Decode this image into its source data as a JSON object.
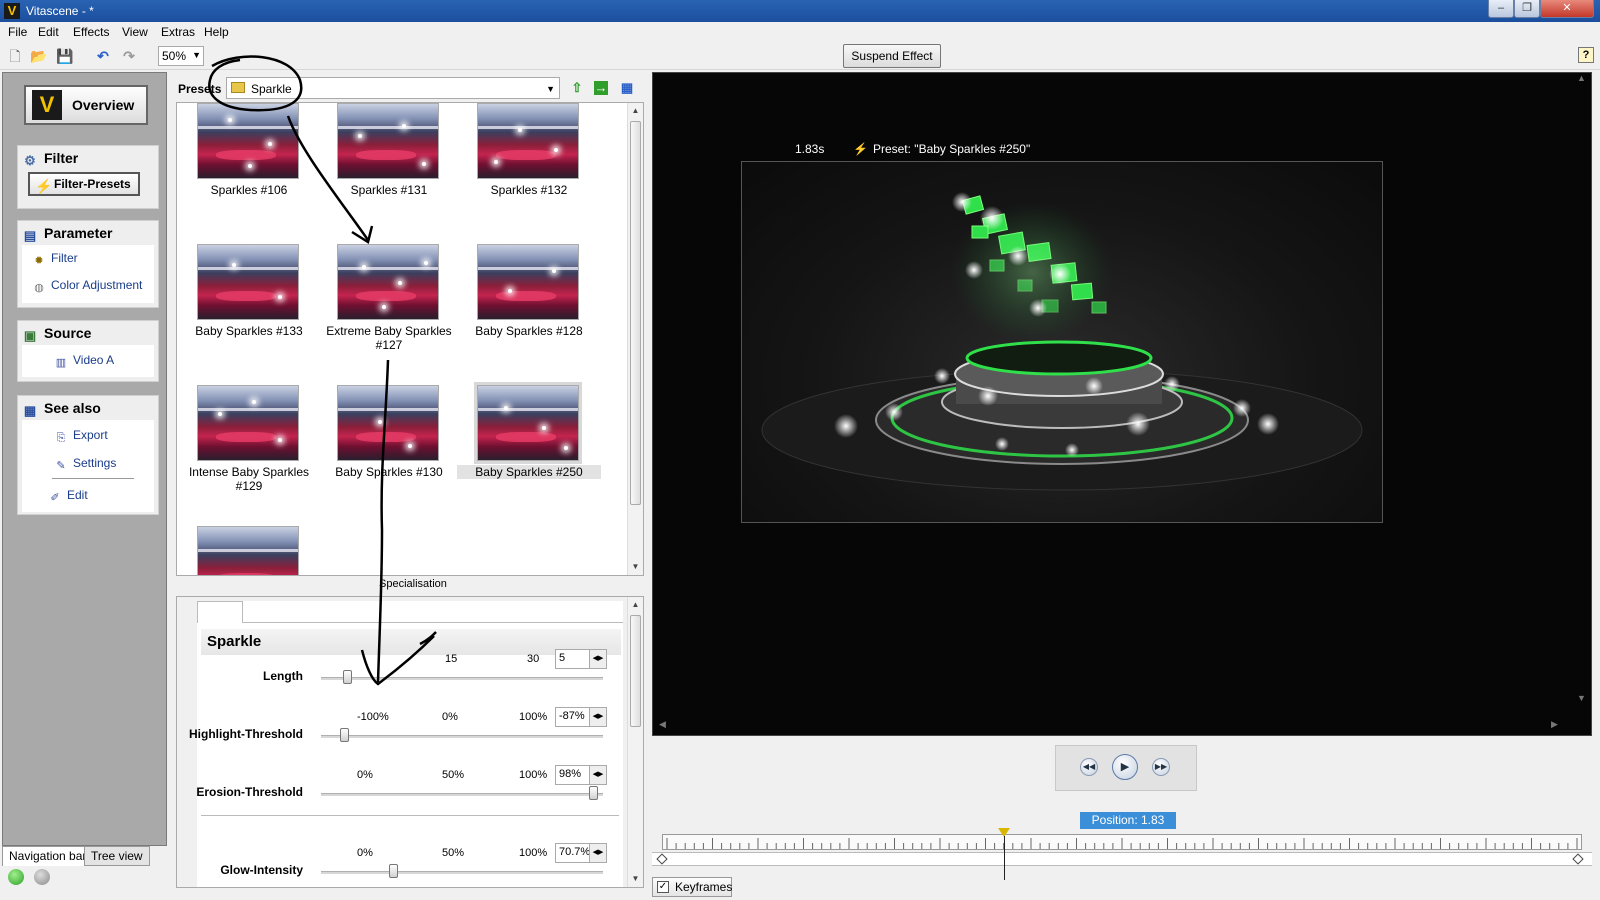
{
  "window": {
    "title": "Vitascene - *",
    "app_icon": "V",
    "controls": [
      "‒",
      "❐",
      "✕"
    ]
  },
  "menu": [
    "File",
    "Edit",
    "Effects",
    "View",
    "Extras",
    "Help"
  ],
  "toolbar": {
    "zoom": "50%",
    "suspend_label": "Suspend Effect",
    "help_icon": "?"
  },
  "nav": {
    "overview_label": "Overview",
    "filter": {
      "heading": "Filter",
      "presets_button": "Filter-Presets"
    },
    "parameter": {
      "heading": "Parameter",
      "items": [
        "Filter",
        "Color Adjustment"
      ]
    },
    "source": {
      "heading": "Source",
      "items": [
        "Video A"
      ]
    },
    "see_also": {
      "heading": "See also",
      "items": [
        "Export",
        "Settings",
        "Edit"
      ]
    },
    "tabs": [
      "Navigation bar",
      "Tree view"
    ]
  },
  "presets": {
    "label": "Presets",
    "folder": "Sparkle",
    "items": [
      "Sparkles #106",
      "Sparkles #131",
      "Sparkles #132",
      "Baby Sparkles #133",
      "Extreme Baby Sparkles #127",
      "Baby Sparkles #128",
      "Intense Baby Sparkles #129",
      "Baby Sparkles #130",
      "Baby Sparkles #250"
    ],
    "selected": "Baby Sparkles #250"
  },
  "specialisation_label": "Specialisation",
  "parameters": {
    "title": "Sparkle",
    "items": [
      {
        "label": "Length",
        "ticks": [
          "15",
          "30"
        ],
        "value": "5",
        "fraction": 0.08
      },
      {
        "label": "Highlight-Threshold",
        "ticks": [
          "-100%",
          "0%",
          "100%"
        ],
        "value": "-87%",
        "fraction": 0.07
      },
      {
        "label": "Erosion-Threshold",
        "ticks": [
          "0%",
          "50%",
          "100%"
        ],
        "value": "98%",
        "fraction": 0.98
      },
      {
        "label": "Glow-Intensity",
        "ticks": [
          "0%",
          "50%",
          "100%"
        ],
        "value": "70.7%",
        "fraction": 0.25
      }
    ]
  },
  "preview": {
    "time": "1.83s",
    "preset_text": "Preset: \"Baby Sparkles #250\""
  },
  "position_label": "Position: 1.83 sec.",
  "keyframes_label": "Keyframes",
  "colors": {
    "accent": "#3b8fd8",
    "titlebar": "#1b4f9e",
    "marker": "#d9b600",
    "sparkle_green": "#2fe04a"
  }
}
